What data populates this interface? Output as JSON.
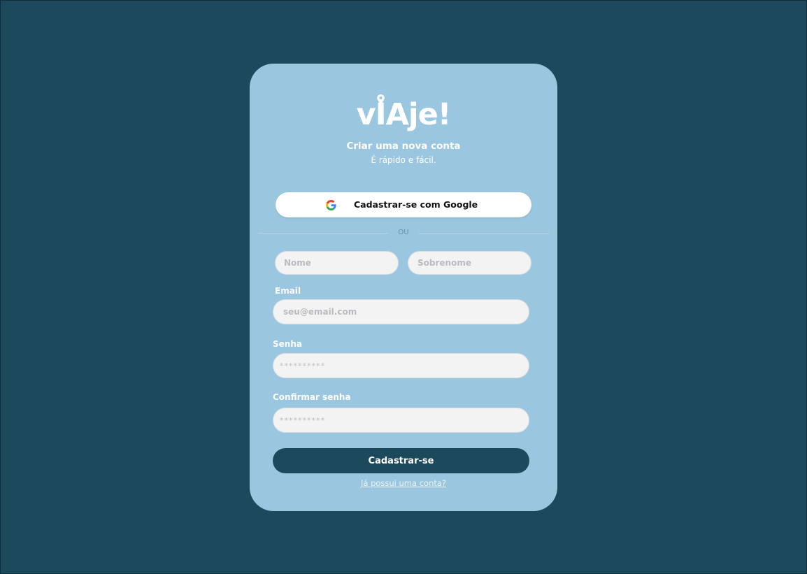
{
  "app": {
    "logo": {
      "before": "v",
      "pin_letter": "I",
      "after": "Aje!"
    },
    "subtitle": "Criar uma nova conta",
    "tagline": "É rápido e fácil."
  },
  "google_button": {
    "label": "Cadastrar-se com Google",
    "icon": "google-icon"
  },
  "divider": {
    "label": "OU"
  },
  "form": {
    "first_name": {
      "placeholder": "Nome",
      "value": ""
    },
    "last_name": {
      "placeholder": "Sobrenome",
      "value": ""
    },
    "email": {
      "label": "Email",
      "placeholder": "seu@email.com",
      "value": ""
    },
    "password": {
      "label": "Senha",
      "placeholder": "**********",
      "value": ""
    },
    "confirm_password": {
      "label": "Confirmar senha",
      "placeholder": "**********",
      "value": ""
    },
    "submit_label": "Cadastrar-se"
  },
  "login_link": "Já possui uma conta?",
  "colors": {
    "background": "#1c4a5c",
    "card": "#9bc6e0",
    "input_bg": "#f3f3f4",
    "primary_button": "#1c4a5c",
    "text_light": "#ffffff"
  }
}
